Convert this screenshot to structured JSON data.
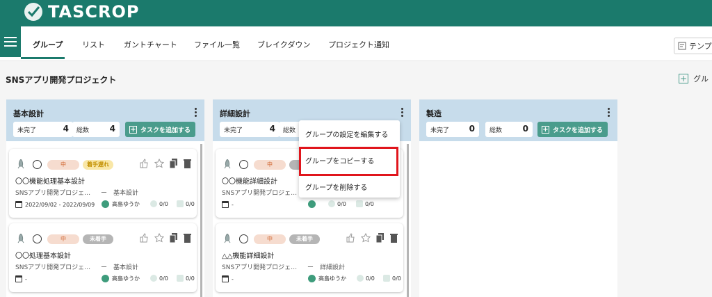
{
  "app": {
    "name": "TASCROP"
  },
  "tabs": [
    {
      "label": "グループ",
      "active": true
    },
    {
      "label": "リスト"
    },
    {
      "label": "ガントチャート"
    },
    {
      "label": "ファイル一覧"
    },
    {
      "label": "ブレイクダウン"
    },
    {
      "label": "プロジェクト通知"
    }
  ],
  "template_button": {
    "label": "テンプ"
  },
  "project": {
    "title": "SNSアプリ開発プロジェクト"
  },
  "add_group": {
    "label": "グル"
  },
  "columns": [
    {
      "title": "基本設計",
      "incomplete_label": "未完了",
      "incomplete_count": "4",
      "total_label": "総数",
      "total_count": "4",
      "add_task_label": "タスクを追加する",
      "cards": [
        {
          "priority": "中",
          "status": "着手遅れ",
          "name": "〇〇機能処理基本設計",
          "project": "SNSアプリ開発プロジェ…",
          "group": "ー　基本設計",
          "date": "2022/09/02 - 2022/09/09",
          "user": "高島ゆうか",
          "count1": "0/0",
          "count2": "0/0"
        },
        {
          "priority": "中",
          "status": "未着手",
          "name": "〇〇処理基本設計",
          "project": "SNSアプリ開発プロジェ…",
          "group": "ー　基本設計",
          "date": "-",
          "user": "高島ゆうか",
          "count1": "0/0",
          "count2": "0/0"
        }
      ]
    },
    {
      "title": "詳細設計",
      "incomplete_label": "未完了",
      "incomplete_count": "4",
      "total_label": "総数",
      "cards": [
        {
          "priority": "中",
          "name": "〇〇機能詳細設計",
          "project": "SNSアプリ開発プロジェ…",
          "date": "-",
          "count1": "0/0",
          "count2": "0/0"
        },
        {
          "priority": "中",
          "status": "未着手",
          "name": "△△機能詳細設計",
          "project": "SNSアプリ開発プロジェ…",
          "group": "ー　詳細設計",
          "date": "-",
          "user": "高島ゆうか",
          "count1": "0/0",
          "count2": "0/0"
        }
      ]
    },
    {
      "title": "製造",
      "incomplete_label": "未完了",
      "incomplete_count": "0",
      "total_label": "総数",
      "total_count": "0",
      "add_task_label": "タスクを追加する"
    }
  ],
  "group_menu": {
    "items": [
      {
        "label": "グループの設定を編集する"
      },
      {
        "label": "グループをコピーする",
        "highlighted": true
      },
      {
        "label": "グループを削除する"
      }
    ]
  },
  "colors": {
    "header": "#1b7a6c",
    "accent": "#4a9c8c",
    "column_header": "#c7dceb",
    "highlight": "#e0151c"
  }
}
